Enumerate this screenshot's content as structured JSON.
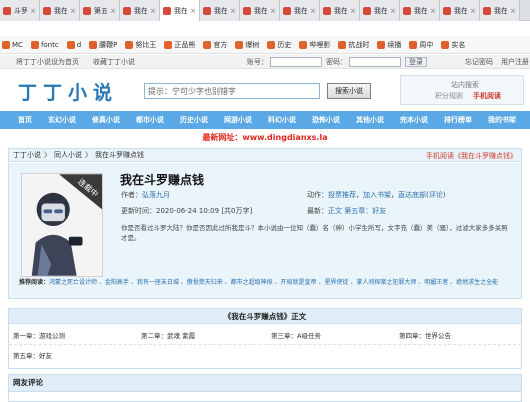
{
  "browser": {
    "tabs": [
      {
        "label": "斗罗之",
        "active": false
      },
      {
        "label": "我在斗",
        "active": false
      },
      {
        "label": "第五影",
        "active": false
      },
      {
        "label": "我在斗",
        "active": false
      },
      {
        "label": "我在斗",
        "active": true
      },
      {
        "label": "我在斗",
        "active": false
      },
      {
        "label": "我在斗",
        "active": false
      },
      {
        "label": "我在斗",
        "active": false
      },
      {
        "label": "我在斗",
        "active": false
      },
      {
        "label": "我在斗",
        "active": false
      },
      {
        "label": "我在斗",
        "active": false
      },
      {
        "label": "我在斗",
        "active": false
      },
      {
        "label": "我在斗",
        "active": false
      }
    ],
    "bookmarks": [
      "MC",
      "fontc",
      "d",
      "腰鞭P",
      "努比王",
      "正品熊",
      "官方",
      "爆树",
      "历史",
      "哔哩影",
      "抗战时",
      "续播",
      "周中",
      "实名"
    ]
  },
  "site_top": {
    "left_links": [
      "将丁丁小说设为首页",
      "收藏丁丁小说"
    ],
    "account_label": "账号：",
    "password_label": "密码：",
    "login_button": "登录",
    "right_links": [
      "忘记密码",
      "用户注册"
    ]
  },
  "header": {
    "logo": "丁丁小说",
    "search_placeholder": "提示：宁可少字也别错字",
    "search_button": "搜索小说",
    "mobile_top": "站内搜索",
    "mobile_left": "积分规则",
    "mobile_right": "手机阅读"
  },
  "nav": [
    "首页",
    "玄幻小说",
    "修真小说",
    "都市小说",
    "历史小说",
    "网游小说",
    "科幻小说",
    "恐怖小说",
    "其他小说",
    "完本小说",
    "排行榜单",
    "我的书架"
  ],
  "notice": "最新网址：www.dingdianxs.la",
  "breadcrumb": {
    "items": [
      "丁丁小说",
      "同人小说",
      "我在斗罗赚点钱"
    ],
    "mobile_read": "手机阅读《我在斗罗赚点钱》"
  },
  "book": {
    "title": "我在斗罗赚点钱",
    "cover_badge": "连载中",
    "author_label": "作者：",
    "author": "弘落九月",
    "actions_label": "动作：",
    "actions": [
      "投票推荐",
      "加入书架",
      "直达底部",
      "评论"
    ],
    "updated_label": "更新时间：",
    "updated": "2020-06-24 10:09",
    "words": "[共0万字]",
    "latest_label": "最新：",
    "latest_a": "正文",
    "latest_b": "第五章：好友",
    "description": "你是否看过斗罗大陆？你是否因此过所我是斗？本小说由一位知（蠢）名（绅）小学生所写，文字充（蠢）美（骚），过滤大家多多关照才是。",
    "recommend_label": "推荐阅读：",
    "recommend": "鸿蒙之死亡设计师 、金阳高手 、我有一座末日城 、傲骨焚天归来 、都市之超级神探 、开局就是皇帝 、星界使徒 、掌人间探案之犯罪大师 、明媚王者 、绝地求生之全能"
  },
  "chapters": {
    "heading": "《我在斗罗赚点钱》正文",
    "list": [
      "第一章：游戏公测",
      "第二章：武魂 紫霞",
      "第三章：A级任务",
      "第四章：世界公告",
      "第五章：好友"
    ]
  },
  "comments": {
    "heading": "网友评论"
  }
}
